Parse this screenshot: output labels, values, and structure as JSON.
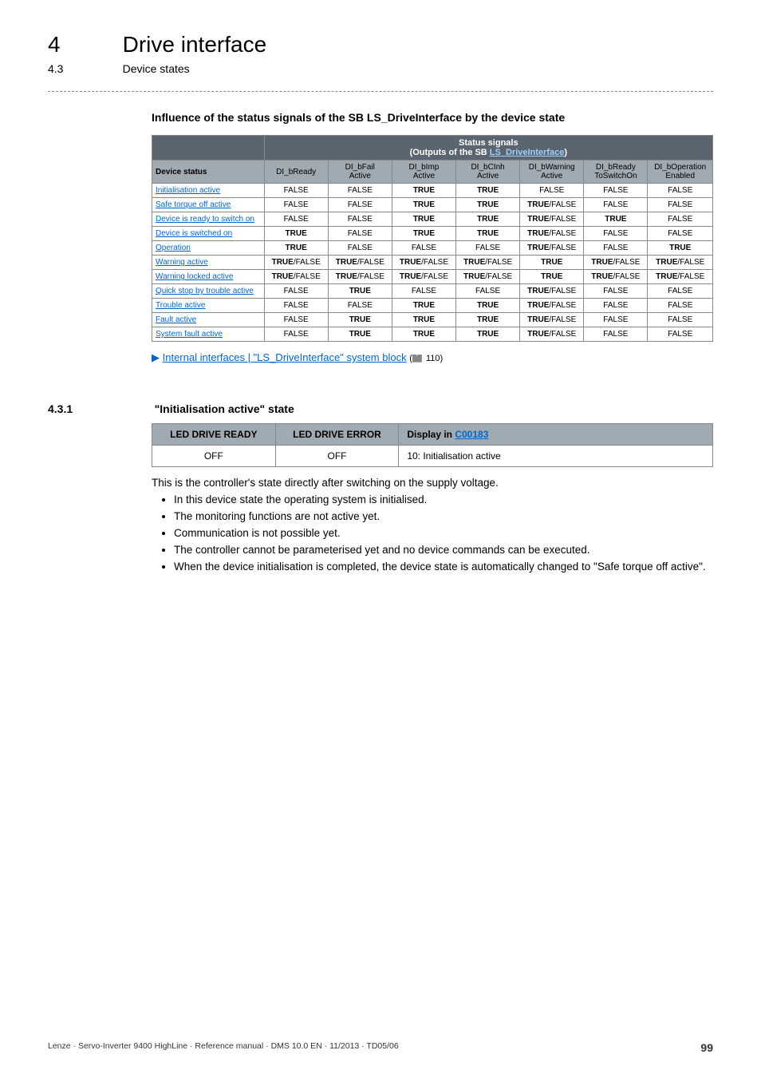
{
  "header": {
    "chapter_num": "4",
    "chapter_title": "Drive interface",
    "sub_num": "4.3",
    "sub_title": "Device states"
  },
  "section1": {
    "heading": "Influence of the status signals of the SB LS_DriveInterface by the device state",
    "table": {
      "group_header_left": "",
      "group_header_right_a": "Status signals",
      "group_header_right_b_pre": "(Outputs of the SB ",
      "group_header_right_b_link": "LS_DriveInterface",
      "group_header_right_b_post": ")",
      "col_headers": [
        "Device status",
        "DI_bReady",
        "DI_bFail\nActive",
        "DI_bImp\nActive",
        "DI_bCInh\nActive",
        "DI_bWarning\nActive",
        "DI_bReady\nToSwitchOn",
        "DI_bOperation\nEnabled"
      ],
      "rows": [
        {
          "label": "Initialisation active",
          "cells": [
            "FALSE",
            "FALSE",
            "TRUE",
            "TRUE",
            "FALSE",
            "FALSE",
            "FALSE"
          ]
        },
        {
          "label": "Safe torque off active",
          "cells": [
            "FALSE",
            "FALSE",
            "TRUE",
            "TRUE",
            "TRUE/FALSE",
            "FALSE",
            "FALSE"
          ]
        },
        {
          "label": "Device is ready to switch on",
          "cells": [
            "FALSE",
            "FALSE",
            "TRUE",
            "TRUE",
            "TRUE/FALSE",
            "TRUE",
            "FALSE"
          ]
        },
        {
          "label": "Device is switched on",
          "cells": [
            "TRUE",
            "FALSE",
            "TRUE",
            "TRUE",
            "TRUE/FALSE",
            "FALSE",
            "FALSE"
          ]
        },
        {
          "label": "Operation",
          "cells": [
            "TRUE",
            "FALSE",
            "FALSE",
            "FALSE",
            "TRUE/FALSE",
            "FALSE",
            "TRUE"
          ]
        },
        {
          "label": "Warning active",
          "cells": [
            "TRUE/FALSE",
            "TRUE/FALSE",
            "TRUE/FALSE",
            "TRUE/FALSE",
            "TRUE",
            "TRUE/FALSE",
            "TRUE/FALSE"
          ]
        },
        {
          "label": "Warning locked active",
          "cells": [
            "TRUE/FALSE",
            "TRUE/FALSE",
            "TRUE/FALSE",
            "TRUE/FALSE",
            "TRUE",
            "TRUE/FALSE",
            "TRUE/FALSE"
          ]
        },
        {
          "label": "Quick stop by trouble active",
          "cells": [
            "FALSE",
            "TRUE",
            "FALSE",
            "FALSE",
            "TRUE/FALSE",
            "FALSE",
            "FALSE"
          ]
        },
        {
          "label": "Trouble active",
          "cells": [
            "FALSE",
            "FALSE",
            "TRUE",
            "TRUE",
            "TRUE/FALSE",
            "FALSE",
            "FALSE"
          ]
        },
        {
          "label": "Fault active",
          "cells": [
            "FALSE",
            "TRUE",
            "TRUE",
            "TRUE",
            "TRUE/FALSE",
            "FALSE",
            "FALSE"
          ]
        },
        {
          "label": "System fault active",
          "cells": [
            "FALSE",
            "TRUE",
            "TRUE",
            "TRUE",
            "TRUE/FALSE",
            "FALSE",
            "FALSE"
          ]
        }
      ]
    },
    "xref": {
      "arrow": "▶",
      "text": "Internal interfaces | \"LS_DriveInterface\" system block",
      "page_pre": "(",
      "page_num": " 110)",
      "page_sym": ""
    }
  },
  "section2": {
    "num": "4.3.1",
    "title": "\"Initialisation active\" state",
    "ledtable": {
      "h1": "LED DRIVE READY",
      "h2": "LED DRIVE ERROR",
      "h3_pre": "Display in ",
      "h3_link": "C00183",
      "r1c1": "OFF",
      "r1c2": "OFF",
      "r1c3": "10: Initialisation active"
    },
    "intro": "This is the controller's state directly after switching on the supply voltage.",
    "bullets": [
      "In this device state the operating system is initialised.",
      "The monitoring functions are not active yet.",
      "Communication is not possible yet.",
      "The controller cannot be parameterised yet and no device commands can be executed.",
      "When the device initialisation is completed, the device state is automatically changed to \"Safe torque off active\"."
    ]
  },
  "footer": {
    "text": "Lenze · Servo-Inverter 9400 HighLine · Reference manual · DMS 10.0 EN · 11/2013 · TD05/06",
    "page": "99"
  }
}
